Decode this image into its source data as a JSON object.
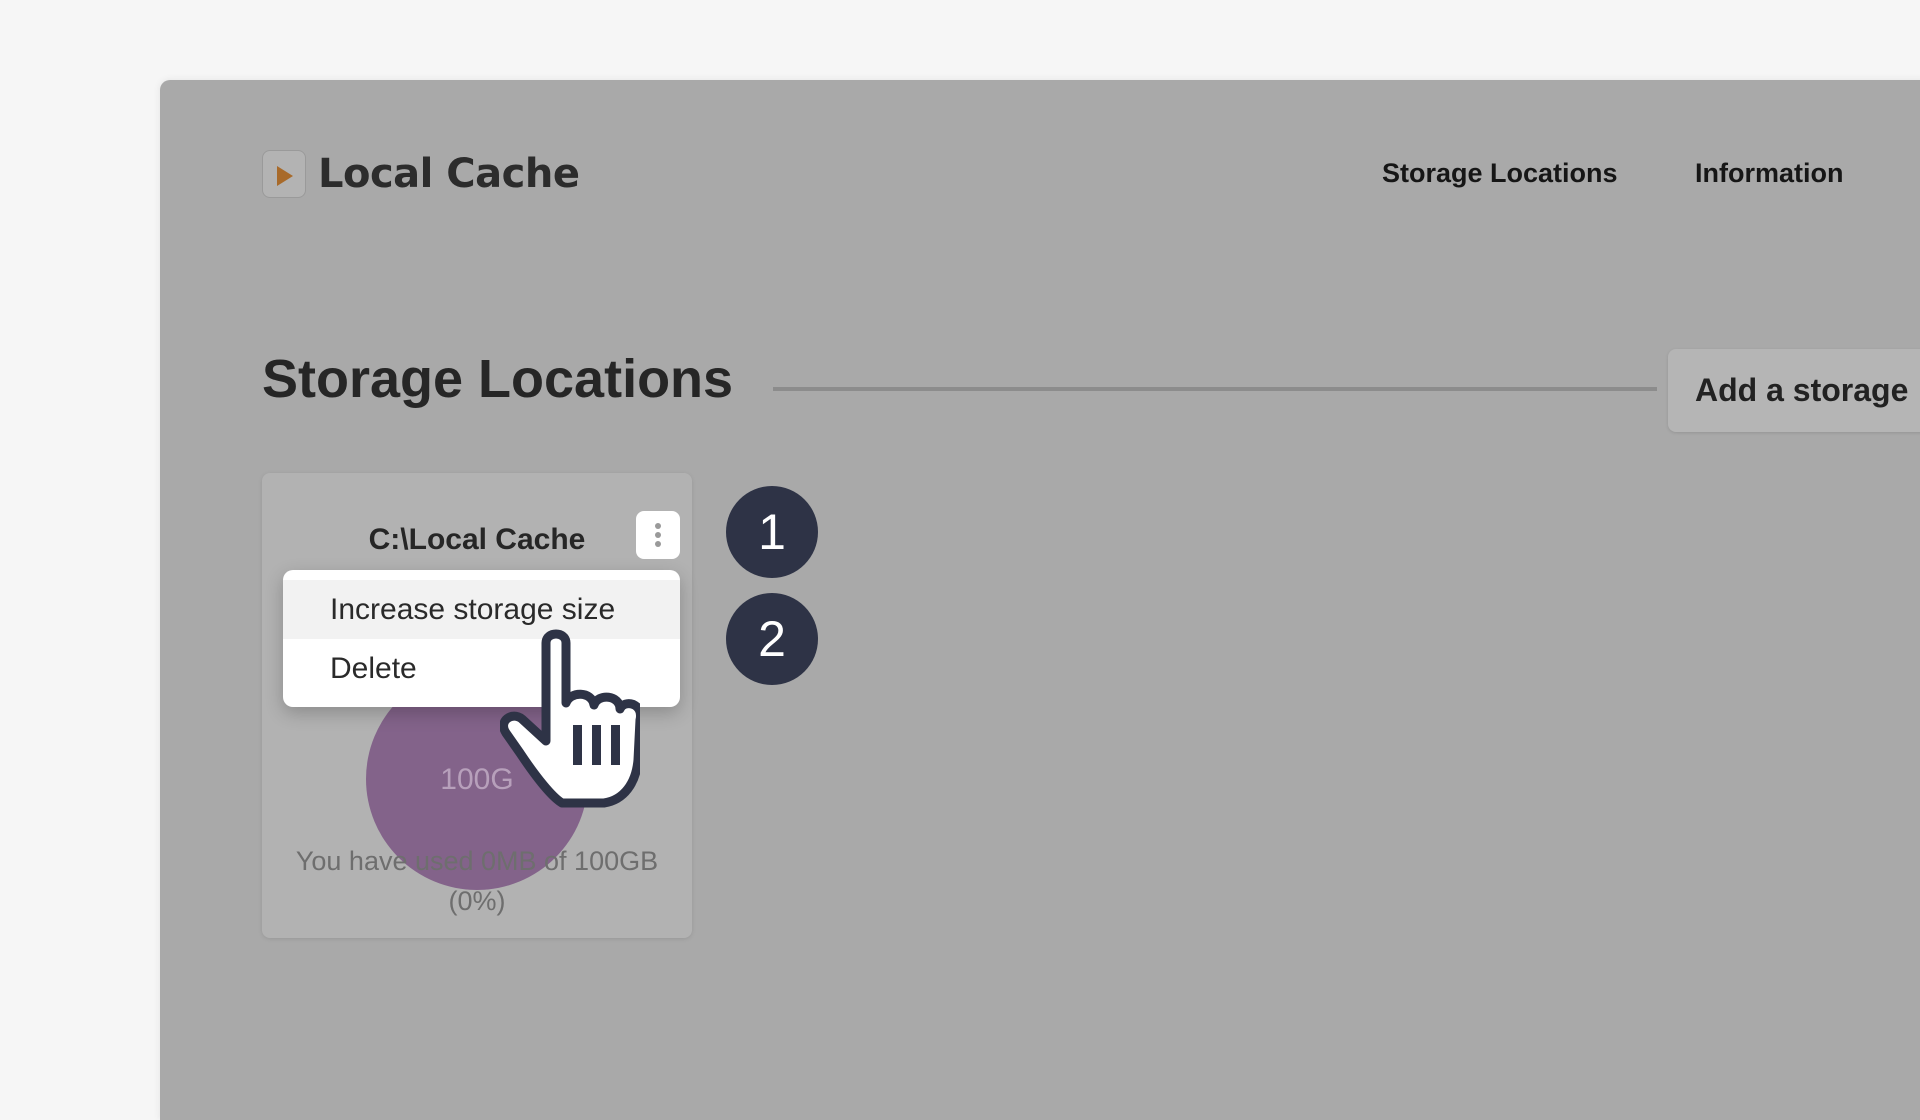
{
  "app": {
    "name": "Local Cache",
    "logo_icon": "play-icon",
    "accent": "#a86a2a"
  },
  "nav": {
    "items": [
      {
        "label": "Storage Locations"
      },
      {
        "label": "Information"
      }
    ]
  },
  "main": {
    "title": "Storage Locations",
    "add_button_label": "Add a storage"
  },
  "storage_cards": [
    {
      "path": "C:\\Local Cache",
      "pie_label": "100G",
      "usage_line1": "You have used 0MB of 100GB",
      "usage_line2": "(0%)",
      "used_percent": 0,
      "pie_color": "#83638a",
      "menu_icon": "more-vertical-icon"
    }
  ],
  "context_menu": {
    "items": [
      {
        "label": "Increase storage size",
        "hovered": true
      },
      {
        "label": "Delete",
        "hovered": false
      }
    ]
  },
  "steps": [
    {
      "number": "1"
    },
    {
      "number": "2"
    }
  ],
  "cursor": {
    "icon": "hand-pointer-icon"
  }
}
